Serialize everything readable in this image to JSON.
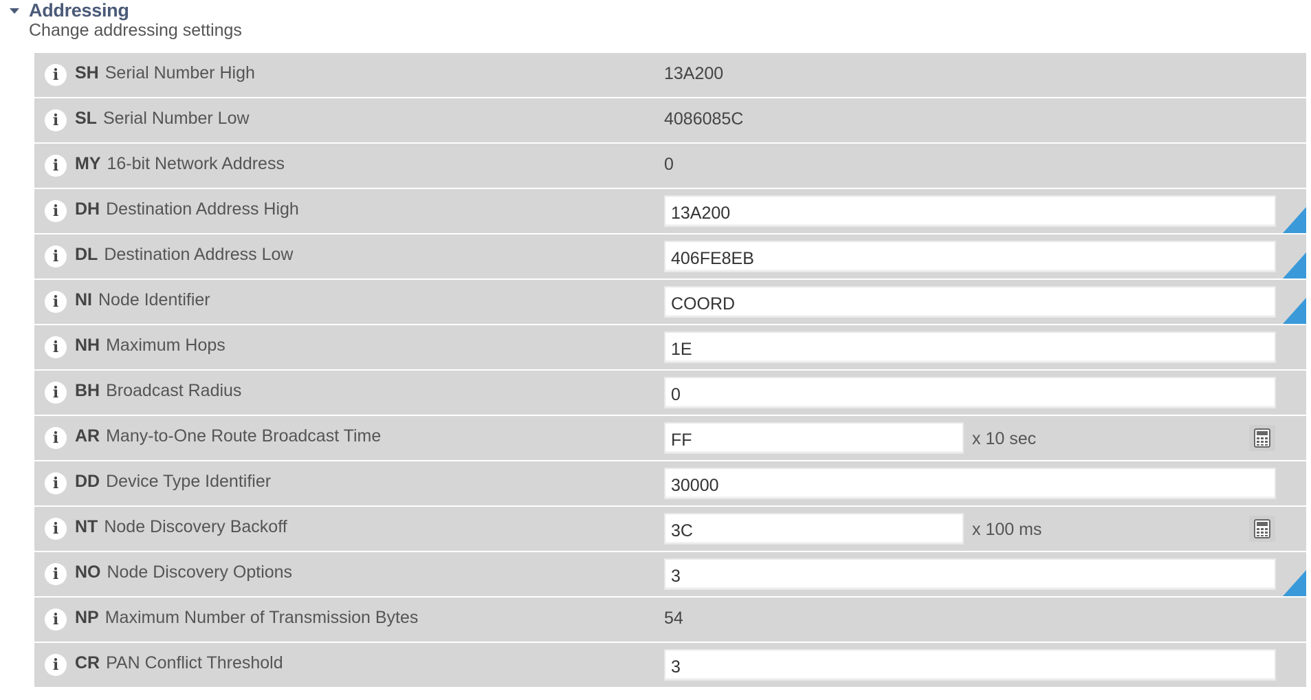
{
  "section": {
    "title": "Addressing",
    "description": "Change addressing settings"
  },
  "icons": {
    "info": "info-icon",
    "calculator": "calculator-icon",
    "collapse": "chevron-down-icon"
  },
  "colors": {
    "row_background": "#d6d6d6",
    "title": "#4a5a78",
    "changed_marker": "#3a9ad9"
  },
  "rows": [
    {
      "code": "SH",
      "label": "Serial Number High",
      "value": "13A200"
    },
    {
      "code": "SL",
      "label": "Serial Number Low",
      "value": "4086085C"
    },
    {
      "code": "MY",
      "label": "16-bit Network Address",
      "value": "0"
    },
    {
      "code": "DH",
      "label": "Destination Address High",
      "value": "13A200"
    },
    {
      "code": "DL",
      "label": "Destination Address Low",
      "value": "406FE8EB"
    },
    {
      "code": "NI",
      "label": "Node Identifier",
      "value": "COORD"
    },
    {
      "code": "NH",
      "label": "Maximum Hops",
      "value": "1E"
    },
    {
      "code": "BH",
      "label": "Broadcast Radius",
      "value": "0"
    },
    {
      "code": "AR",
      "label": "Many-to-One Route Broadcast Time",
      "value": "FF",
      "unit": "x 10 sec"
    },
    {
      "code": "DD",
      "label": "Device Type Identifier",
      "value": "30000"
    },
    {
      "code": "NT",
      "label": "Node Discovery Backoff",
      "value": "3C",
      "unit": "x 100 ms"
    },
    {
      "code": "NO",
      "label": "Node Discovery Options",
      "value": "3"
    },
    {
      "code": "NP",
      "label": "Maximum Number of Transmission Bytes",
      "value": "54"
    },
    {
      "code": "CR",
      "label": "PAN Conflict Threshold",
      "value": "3"
    }
  ],
  "info_glyph": "i"
}
